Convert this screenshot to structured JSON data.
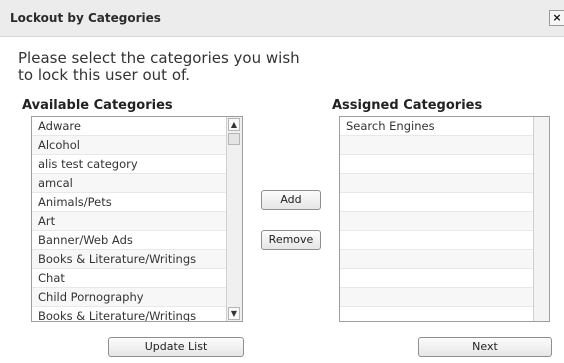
{
  "dialog": {
    "title": "Lockout by Categories",
    "close_label": "×",
    "prompt": "Please select the categories you wish to lock this user out of."
  },
  "available": {
    "header": "Available Categories",
    "items": [
      "Adware",
      "Alcohol",
      "alis test category",
      "amcal",
      "Animals/Pets",
      "Art",
      "Banner/Web Ads",
      "Books & Literature/Writings",
      "Chat",
      "Child Pornography",
      "Books & Literature/Writings"
    ],
    "scroll_up_icon": "▲",
    "scroll_down_icon": "▼"
  },
  "assigned": {
    "header": "Assigned Categories",
    "items": [
      "Search Engines"
    ]
  },
  "buttons": {
    "add": "Add",
    "remove": "Remove",
    "update_list": "Update List",
    "next": "Next"
  }
}
